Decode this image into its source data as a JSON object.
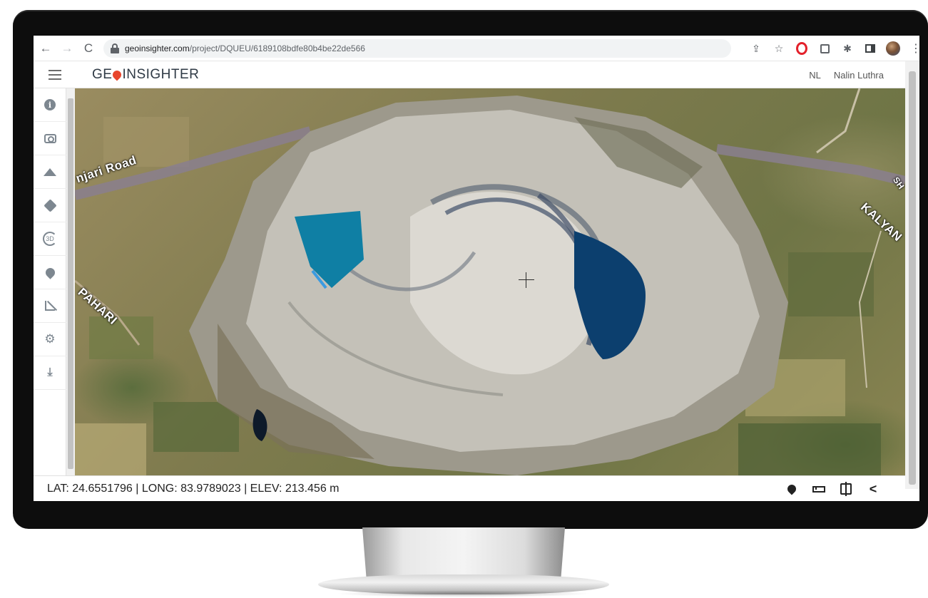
{
  "browser": {
    "url_domain": "geoinsighter.com",
    "url_path": "/project/DQUEU/6189108bdfe80b4be22de566",
    "back_glyph": "←",
    "forward_glyph": "→",
    "reload_glyph": "C",
    "share_glyph": "⇪",
    "star_glyph": "☆",
    "puzzle_glyph": "✱",
    "kebab_glyph": "⋮"
  },
  "header": {
    "logo_left": "GE",
    "logo_right": "INSIGHTER",
    "user_initials": "NL",
    "user_name": "Nalin Luthra"
  },
  "left_toolbar": {
    "items": [
      {
        "icon": "info-icon",
        "glyph": "i"
      },
      {
        "icon": "camera-icon"
      },
      {
        "icon": "terrain-icon"
      },
      {
        "icon": "layers-icon"
      },
      {
        "icon": "view-3d-icon",
        "glyph": "3D"
      },
      {
        "icon": "location-pin-icon"
      },
      {
        "icon": "measure-icon"
      },
      {
        "icon": "settings-icon",
        "glyph": "⚙"
      },
      {
        "icon": "download-icon",
        "glyph": "⤓"
      }
    ]
  },
  "map": {
    "road_labels": [
      {
        "text": "njari Road"
      },
      {
        "text": "KALYAN"
      },
      {
        "text": "PAHARI"
      },
      {
        "text": "SH"
      }
    ]
  },
  "status_bar": {
    "coordinates": "LAT: 24.6551796 | LONG: 83.9789023 | ELEV: 213.456 m",
    "icons": [
      "add-marker-icon",
      "ruler-icon",
      "compare-icon",
      "share-icon"
    ],
    "share_glyph": "<"
  },
  "colors": {
    "logo_pin": "#e8452c",
    "opera_red": "#e3212b",
    "pit_water": "#0f7fa4",
    "deep_water": "#0c3f6e"
  }
}
